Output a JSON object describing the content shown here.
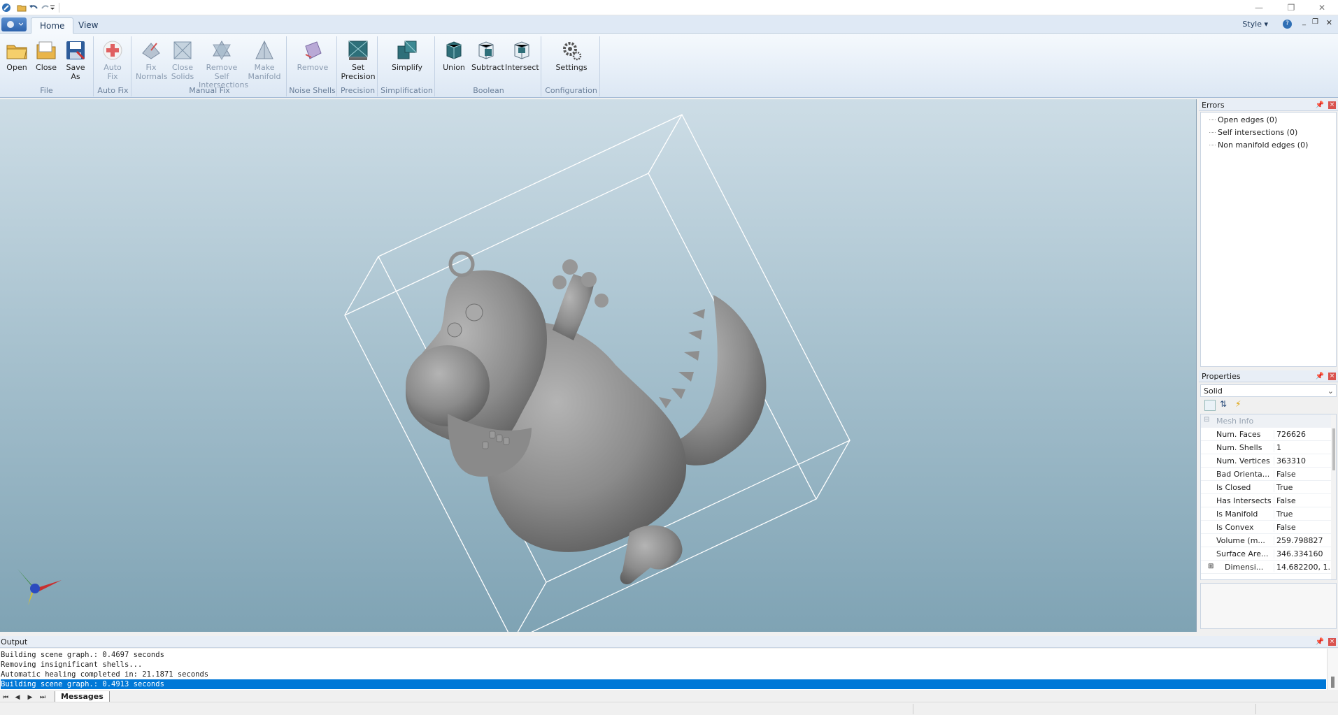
{
  "window": {
    "minimize": "—",
    "restore": "❐",
    "close": "✕"
  },
  "tabs": [
    {
      "label": "Home"
    },
    {
      "label": "View"
    }
  ],
  "style_menu": "Style",
  "ribbon": {
    "groups": [
      {
        "label": "File",
        "buttons": [
          "Open",
          "Close",
          "Save As"
        ]
      },
      {
        "label": "Auto Fix",
        "buttons": [
          "Auto Fix"
        ]
      },
      {
        "label": "Manual Fix",
        "buttons": [
          "Fix Normals",
          "Close Solids",
          "Remove Self Intersections",
          "Make Manifold"
        ]
      },
      {
        "label": "Noise Shells",
        "buttons": [
          "Remove"
        ]
      },
      {
        "label": "Precision",
        "buttons": [
          "Set Precision"
        ]
      },
      {
        "label": "Simplification",
        "buttons": [
          "Simplify"
        ]
      },
      {
        "label": "Boolean",
        "buttons": [
          "Union",
          "Subtract",
          "Intersect"
        ]
      },
      {
        "label": "Configuration",
        "buttons": [
          "Settings"
        ]
      }
    ]
  },
  "errors_panel": {
    "title": "Errors",
    "items": [
      "Open edges (0)",
      "Self intersections (0)",
      "Non manifold edges (0)"
    ]
  },
  "properties_panel": {
    "title": "Properties",
    "selected_object": "Solid",
    "category": "Mesh Info",
    "rows": [
      {
        "name": "Num. Faces",
        "value": "726626"
      },
      {
        "name": "Num. Shells",
        "value": "1"
      },
      {
        "name": "Num. Vertices",
        "value": "363310"
      },
      {
        "name": "Bad Orienta...",
        "value": "False"
      },
      {
        "name": "Is Closed",
        "value": "True"
      },
      {
        "name": "Has Intersects",
        "value": "False"
      },
      {
        "name": "Is Manifold",
        "value": "True"
      },
      {
        "name": "Is Convex",
        "value": "False"
      },
      {
        "name": "Volume (m...",
        "value": "259.798827"
      },
      {
        "name": "Surface Are...",
        "value": "346.334160"
      },
      {
        "name": "Dimensi...",
        "value": "14.682200, 1..."
      }
    ]
  },
  "output_panel": {
    "title": "Output",
    "lines": [
      "Building scene graph.: 0.4697 seconds",
      "Removing insignificant shells...",
      "Automatic healing completed in: 21.1871 seconds",
      "Building scene graph.: 0.4913 seconds"
    ],
    "tab": "Messages"
  },
  "colors": {
    "accent": "#0078d7",
    "ribbon_bg": "#dce7f4",
    "viewport_top": "#cddde6",
    "viewport_bottom": "#7fa3b4",
    "model": "#8e8e8e"
  }
}
